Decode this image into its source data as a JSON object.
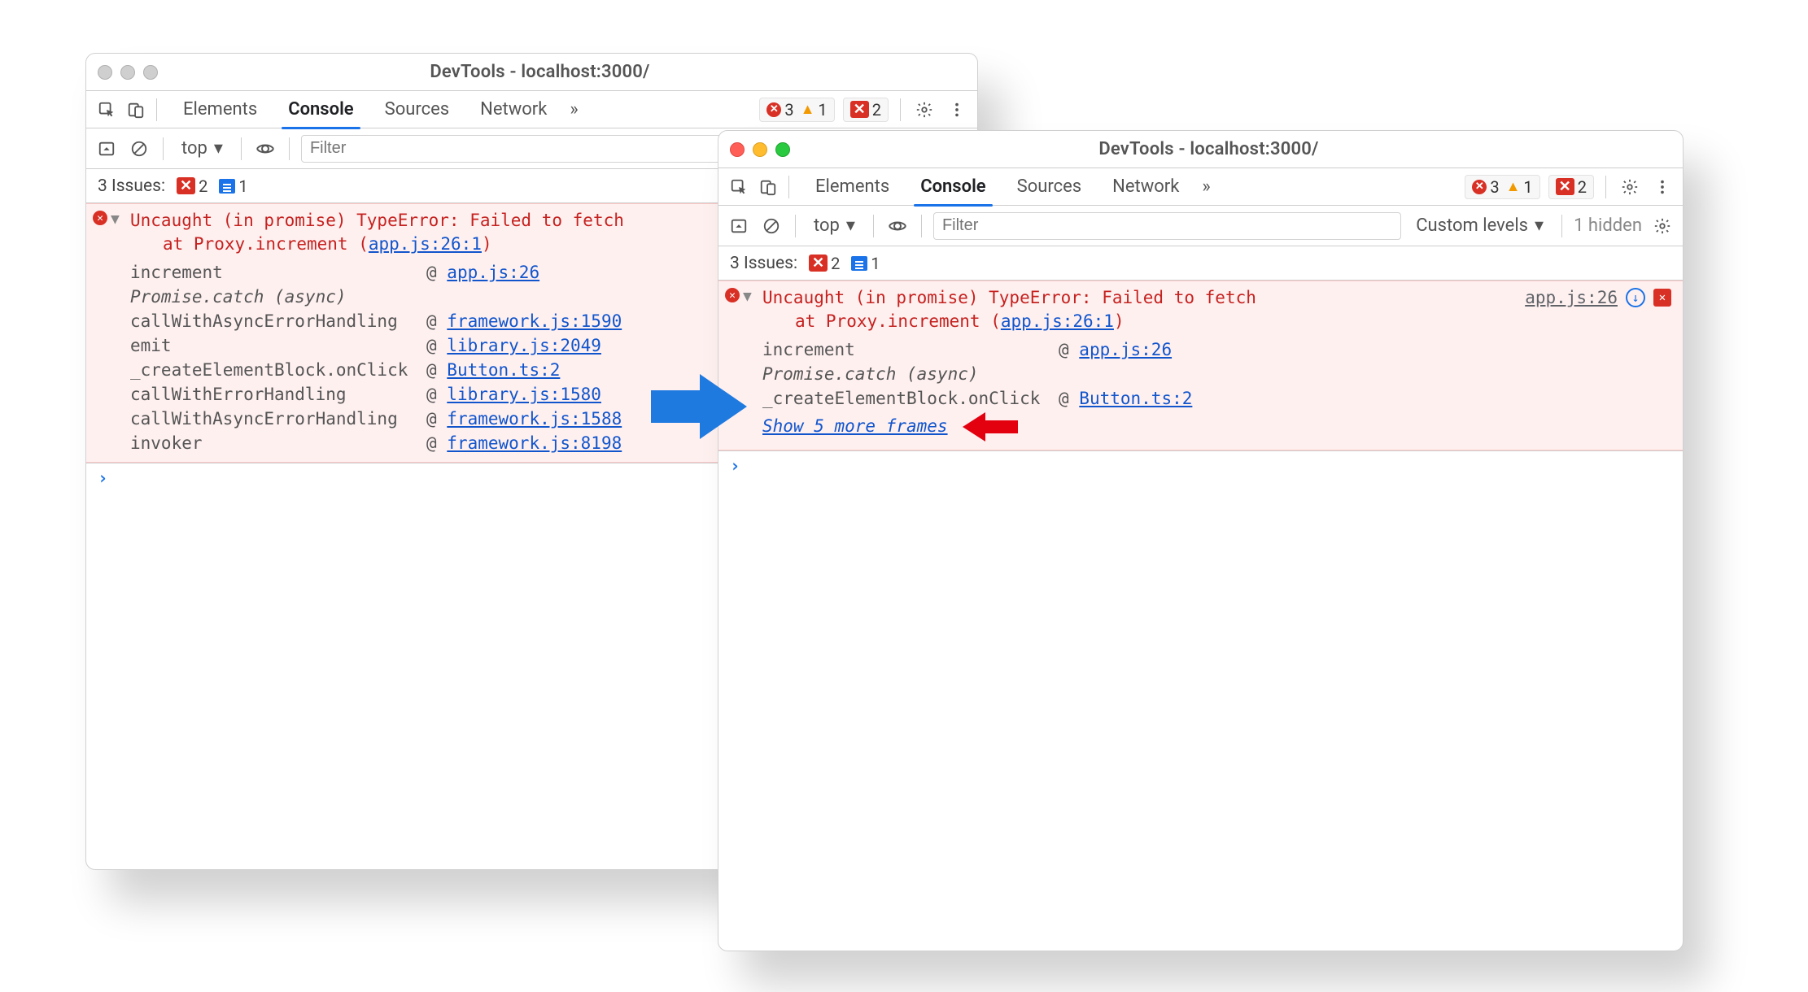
{
  "title": "DevTools - localhost:3000/",
  "tabs": {
    "elements": "Elements",
    "console": "Console",
    "sources": "Sources",
    "network": "Network",
    "more": "»"
  },
  "badges": {
    "errors": "3",
    "warnings": "1",
    "red_box": "2"
  },
  "toolbar": {
    "context": "top",
    "filter_placeholder": "Filter",
    "levels": "Custom levels",
    "hidden": "1 hidden"
  },
  "issues": {
    "label": "3 Issues:",
    "err_count": "2",
    "info_count": "1"
  },
  "error": {
    "headline": "Uncaught (in promise) TypeError: Failed to fetch",
    "at_prefix": "at Proxy.increment (",
    "at_link": "app.js:26:1",
    "source_link": "app.js:26"
  },
  "frames_full": [
    {
      "fn": "increment",
      "src": "app.js:26"
    },
    {
      "fn": "Promise.catch (async)",
      "italic": true
    },
    {
      "fn": "callWithAsyncErrorHandling",
      "src": "framework.js:1590"
    },
    {
      "fn": "emit",
      "src": "library.js:2049"
    },
    {
      "fn": "_createElementBlock.onClick",
      "src": "Button.ts:2"
    },
    {
      "fn": "callWithErrorHandling",
      "src": "library.js:1580"
    },
    {
      "fn": "callWithAsyncErrorHandling",
      "src": "framework.js:1588"
    },
    {
      "fn": "invoker",
      "src": "framework.js:8198"
    }
  ],
  "frames_compact": [
    {
      "fn": "increment",
      "src": "app.js:26"
    },
    {
      "fn": "Promise.catch (async)",
      "italic": true
    },
    {
      "fn": "_createElementBlock.onClick",
      "src": "Button.ts:2"
    }
  ],
  "show_more": "Show 5 more frames",
  "at_symbol": "@"
}
